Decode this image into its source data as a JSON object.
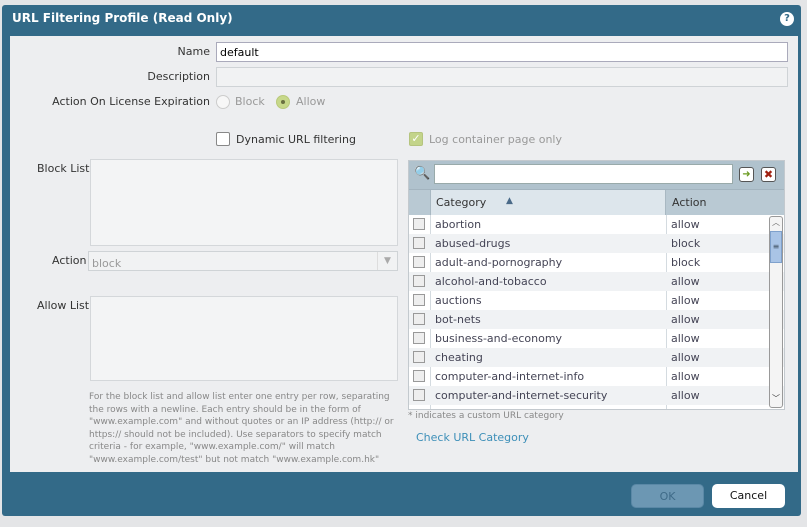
{
  "dialog": {
    "title": "URL Filtering Profile (Read Only)",
    "help_icon": "question-icon"
  },
  "form": {
    "name_label": "Name",
    "name_value": "default",
    "description_label": "Description",
    "description_value": "",
    "license_label": "Action On License Expiration",
    "block_label": "Block",
    "allow_label": "Allow",
    "license_selected": "Allow",
    "dynamic_label": "Dynamic URL filtering",
    "dynamic_checked": false,
    "log_label": "Log container page only",
    "log_checked": true,
    "block_list_label": "Block List",
    "action_label": "Action",
    "action_value": "block",
    "allow_list_label": "Allow List",
    "help_text": "For the block list and allow list enter one entry per row, separating the rows with a newline. Each entry should be in the form of \"www.example.com\" and without quotes or an IP address (http:// or https:// should not be included). Use separators to specify match criteria - for example, \"www.example.com/\" will match \"www.example.com/test\" but not match \"www.example.com.hk\""
  },
  "grid": {
    "search_value": "",
    "col_category": "Category",
    "col_action": "Action",
    "rows": [
      {
        "category": "abortion",
        "action": "allow"
      },
      {
        "category": "abused-drugs",
        "action": "block"
      },
      {
        "category": "adult-and-pornography",
        "action": "block"
      },
      {
        "category": "alcohol-and-tobacco",
        "action": "allow"
      },
      {
        "category": "auctions",
        "action": "allow"
      },
      {
        "category": "bot-nets",
        "action": "allow"
      },
      {
        "category": "business-and-economy",
        "action": "allow"
      },
      {
        "category": "cheating",
        "action": "allow"
      },
      {
        "category": "computer-and-internet-info",
        "action": "allow"
      },
      {
        "category": "computer-and-internet-security",
        "action": "allow"
      }
    ],
    "footnote": "* indicates a custom URL category",
    "check_link": "Check URL Category"
  },
  "footer": {
    "ok": "OK",
    "cancel": "Cancel"
  }
}
